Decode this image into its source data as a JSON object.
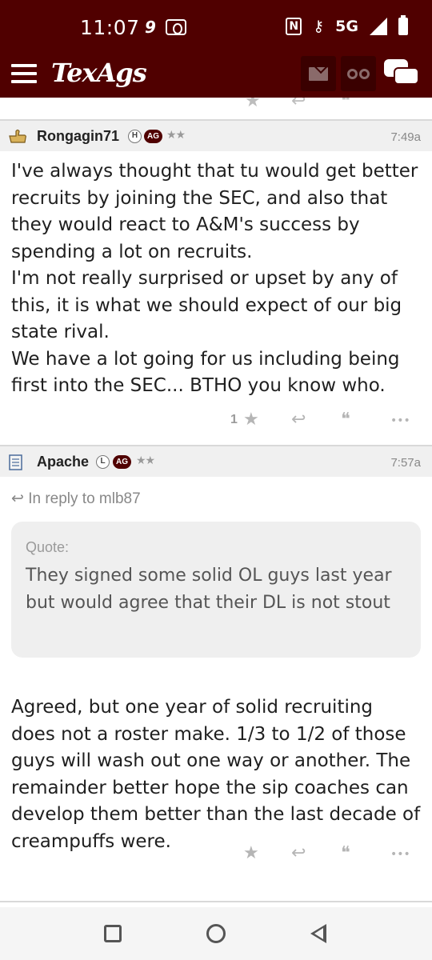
{
  "status_bar": {
    "time": "11:07",
    "left_icons": [
      "9",
      "screen-record-icon"
    ],
    "network": "5G",
    "right_icons": [
      "nfc-icon",
      "key-icon",
      "signal-icon",
      "battery-icon"
    ]
  },
  "header": {
    "logo": "TexAgs",
    "menu_icon": "hamburger-icon",
    "buttons": [
      "mail-icon",
      "binoculars-icon",
      "chat-icon"
    ],
    "brand_color": "#500000"
  },
  "posts": [
    {
      "username": "Rongagin71",
      "badges": [
        "H",
        "AG"
      ],
      "stars": "★★",
      "time": "7:49a",
      "paragraphs": [
        "I've always thought that tu would get better recruits by joining the SEC, and also that they would react to A&M's success by spending a lot on recruits.",
        "I'm not really surprised or upset by any of this, it is what we should expect of our big state rival.",
        "We have a lot going for us including being first into the SEC... BTHO you know who."
      ],
      "star_count": "1",
      "actions": [
        "star-icon",
        "reply-icon",
        "quote-icon",
        "more-icon"
      ]
    },
    {
      "username": "Apache",
      "badges": [
        "L",
        "AG"
      ],
      "stars": "★★",
      "time": "7:57a",
      "reply_to": "In reply to mlb87",
      "quote_label": "Quote:",
      "quote_text": "They signed some solid OL guys last year but would agree that their DL is not stout",
      "paragraphs": [
        "Agreed, but one year of solid recruiting does not a roster make. 1/3 to 1/2 of those guys will wash out one way or another. The remainder better hope the sip coaches can develop them better than the last decade of creampuffs were."
      ],
      "star_count": "",
      "actions": [
        "star-icon",
        "reply-icon",
        "quote-icon",
        "more-icon"
      ]
    }
  ],
  "glyphs": {
    "star": "★",
    "reply": "↩",
    "quote": "❝",
    "more": "•••"
  }
}
